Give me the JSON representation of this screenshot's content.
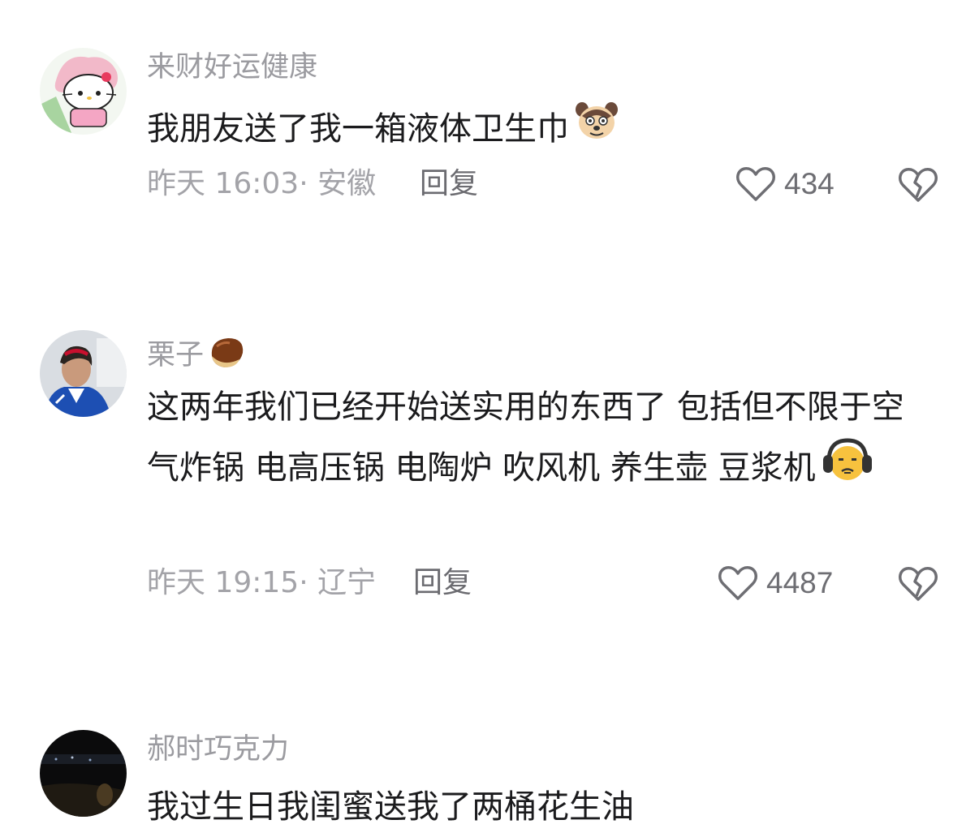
{
  "comments": [
    {
      "username": "来财好运健康",
      "text": "我朋友送了我一箱液体卫生巾",
      "emoji_icon": "dog-face-icon",
      "time": "昨天 16:03",
      "location": "安徽",
      "reply_label": "回复",
      "likes": "434"
    },
    {
      "username": "栗子",
      "username_icon": "chestnut-icon",
      "text": "这两年我们已经开始送实用的东西了 包括但不限于空气炸锅 电高压锅 电陶炉 吹风机 养生壶 豆浆机",
      "emoji_icon": "headphones-face-icon",
      "time": "昨天 19:15",
      "location": "辽宁",
      "reply_label": "回复",
      "likes": "4487"
    },
    {
      "username": "郝时巧克力",
      "text": "我过生日我闺蜜送我了两桶花生油"
    }
  ],
  "colors": {
    "username": "#9b9ba0",
    "body": "#1b1b1d",
    "meta": "#a3a3a8",
    "icon": "#6e6e73"
  }
}
